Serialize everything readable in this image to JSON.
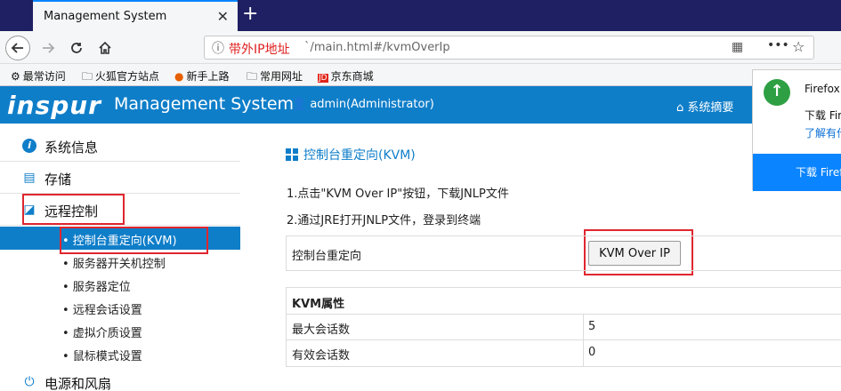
{
  "browser": {
    "tab_title": "Management System",
    "tab_close": "✕",
    "new_tab": "+",
    "url_host": "带外IP地址",
    "url_path": "`/main.html#/kvmOverIp",
    "bookmarks": [
      "最常访问",
      "火狐官方站点",
      "新手上路",
      "常用网址",
      "京东商城"
    ]
  },
  "header": {
    "logo": "inspur",
    "title": "Management System",
    "user": "admin(Administrator)",
    "summary": "系统摘要"
  },
  "sidebar": {
    "items": [
      {
        "label": "系统信息",
        "icon": "info-icon"
      },
      {
        "label": "存储",
        "icon": "storage-icon"
      },
      {
        "label": "远程控制",
        "icon": "remote-control-icon"
      }
    ],
    "subitems": [
      "• 控制台重定向(KVM)",
      "• 服务器开关机控制",
      "• 服务器定位",
      "• 远程会话设置",
      "• 虚拟介质设置",
      "• 鼠标模式设置"
    ],
    "power": {
      "label": "电源和风扇",
      "icon": "power-icon"
    }
  },
  "toast": {
    "title": "Firefox",
    "text": "下载 Fir",
    "link": "了解有什",
    "button": "下载 Firef"
  },
  "main": {
    "title": "控制台重定向(KVM)",
    "instructions": [
      "1.点击\"KVM Over IP\"按钮，下载JNLP文件",
      "2.通过JRE打开JNLP文件，登录到终端"
    ],
    "redirect_label": "控制台重定向",
    "kvm_button": "KVM Over IP",
    "props_header": "KVM属性",
    "props": [
      {
        "label": "最大会话数",
        "value": "5"
      },
      {
        "label": "有效会话数",
        "value": "0"
      }
    ]
  }
}
